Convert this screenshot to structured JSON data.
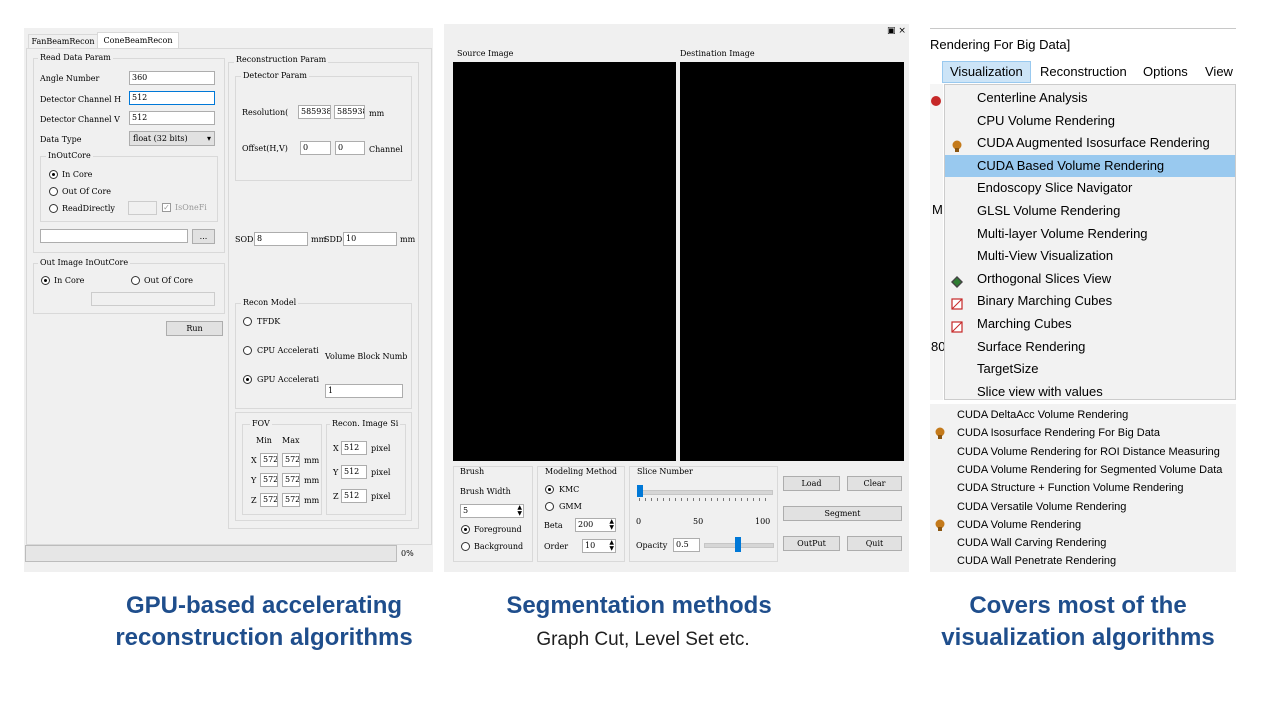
{
  "recon": {
    "tabs": [
      "FanBeamRecon",
      "ConeBeamRecon"
    ],
    "read_data": {
      "title": "Read Data Param",
      "angle_label": "Angle Number",
      "angle_value": "360",
      "ch_h_label": "Detector Channel H",
      "ch_h_value": "512",
      "ch_v_label": "Detector Channel V",
      "ch_v_value": "512",
      "dtype_label": "Data Type",
      "dtype_value": "float (32 bits)",
      "inout_title": "InOutCore",
      "in_core": "In Core",
      "out_of_core": "Out Of Core",
      "read_directly": "ReadDirectly",
      "is_one_file": "IsOneFi",
      "browse": "..."
    },
    "out_image": {
      "title": "Out Image InOutCore",
      "in_core": "In Core",
      "out_of_core": "Out Of Core"
    },
    "run": "Run",
    "progress": {
      "value": 0,
      "text": "0%"
    },
    "recon_param": {
      "title": "Reconstruction Param",
      "detector_title": "Detector Param",
      "resolution_label": "Resolution(",
      "res_x": "585938",
      "res_y": "585938",
      "res_unit": "mm",
      "offset_label": "Offset(H,V)",
      "off_h": "0",
      "off_v": "0",
      "off_unit": "Channel",
      "sod_label": "SOD",
      "sod_value": "8",
      "sod_unit": "mm",
      "sdd_label": "SDD",
      "sdd_value": "10",
      "sdd_unit": "mm",
      "model_title": "Recon Model",
      "fdk": "TFDK",
      "cpu": "CPU Accelerati",
      "gpu": "GPU Accelerati",
      "block_label": "Volume Block Numb",
      "block_value": "1",
      "fov_title": "FOV",
      "fov_min": "Min",
      "fov_max": "Max",
      "fov_x": "X",
      "fov_y": "Y",
      "fov_z": "Z",
      "fov_x_min": "572",
      "fov_x_max": "572",
      "fov_y_min": "572",
      "fov_y_max": "572",
      "fov_z_min": "572",
      "fov_z_max": "572",
      "fov_unit": "mm",
      "size_title": "Recon. Image Si",
      "size_x": "512",
      "size_y": "512",
      "size_z": "512",
      "size_unit": "pixel"
    }
  },
  "seg": {
    "window_icons": "▣ ×",
    "source_label": "Source Image",
    "dest_label": "Destination Image",
    "brush": {
      "title": "Brush",
      "width_label": "Brush Width",
      "width_value": "5",
      "foreground": "Foreground",
      "background": "Background"
    },
    "method": {
      "title": "Modeling Method",
      "kmc": "KMC",
      "gmm": "GMM",
      "beta_label": "Beta",
      "beta_value": "200",
      "order_label": "Order",
      "order_value": "10"
    },
    "slice": {
      "title": "Slice Number",
      "t0": "0",
      "t50": "50",
      "t100": "100",
      "opacity_label": "Opacity",
      "opacity_value": "0.5",
      "slice_pos": 0,
      "opacity_pos": 0.5
    },
    "buttons": {
      "load": "Load",
      "clear": "Clear",
      "segment": "Segment",
      "output": "OutPut",
      "quit": "Quit"
    }
  },
  "vis": {
    "header": "Rendering For Big Data]",
    "menubar": [
      "Visualization",
      "Reconstruction",
      "Options",
      "View"
    ],
    "items": [
      {
        "label": "Centerline Analysis",
        "icon": ""
      },
      {
        "label": "CPU Volume Rendering",
        "icon": ""
      },
      {
        "label": "CUDA Augmented Isosurface Rendering",
        "icon": "head-icon"
      },
      {
        "label": "CUDA Based Volume Rendering",
        "icon": ""
      },
      {
        "label": "Endoscopy Slice Navigator",
        "icon": ""
      },
      {
        "label": "GLSL Volume Rendering",
        "icon": ""
      },
      {
        "label": "Multi-layer Volume Rendering",
        "icon": ""
      },
      {
        "label": "Multi-View Visualization",
        "icon": ""
      },
      {
        "label": "Orthogonal Slices View",
        "icon": "slices-icon"
      },
      {
        "label": "Binary Marching Cubes",
        "icon": "cube-icon"
      },
      {
        "label": "Marching Cubes",
        "icon": "cube-icon"
      },
      {
        "label": "Surface Rendering",
        "icon": ""
      },
      {
        "label": "TargetSize",
        "icon": ""
      },
      {
        "label": "Slice view with values",
        "icon": ""
      }
    ],
    "highlight_index": 3,
    "side_chars": {
      "a": "M",
      "b": "80"
    },
    "submenu": [
      {
        "label": "CUDA DeltaAcc Volume Rendering",
        "icon": ""
      },
      {
        "label": "CUDA Isosurface Rendering For Big Data",
        "icon": "head-icon"
      },
      {
        "label": "CUDA Volume Rendering for ROI Distance Measuring",
        "icon": ""
      },
      {
        "label": "CUDA Volume Rendering for Segmented Volume Data",
        "icon": ""
      },
      {
        "label": "CUDA Structure + Function Volume Rendering",
        "icon": ""
      },
      {
        "label": "CUDA Versatile Volume Rendering",
        "icon": ""
      },
      {
        "label": "CUDA Volume Rendering",
        "icon": "head-icon"
      },
      {
        "label": "CUDA Wall Carving Rendering",
        "icon": ""
      },
      {
        "label": "CUDA Wall Penetrate Rendering",
        "icon": ""
      }
    ]
  },
  "captions": {
    "c1": [
      "GPU-based accelerating",
      "reconstruction algorithms"
    ],
    "c2": [
      "Segmentation methods"
    ],
    "c2_sub": "Graph Cut, Level Set etc.",
    "c3": [
      "Covers most of the",
      "visualization algorithms"
    ]
  },
  "colors": {
    "caption": "#1f4e8c",
    "highlight": "#99c9ef",
    "slider": "#0078d7"
  }
}
